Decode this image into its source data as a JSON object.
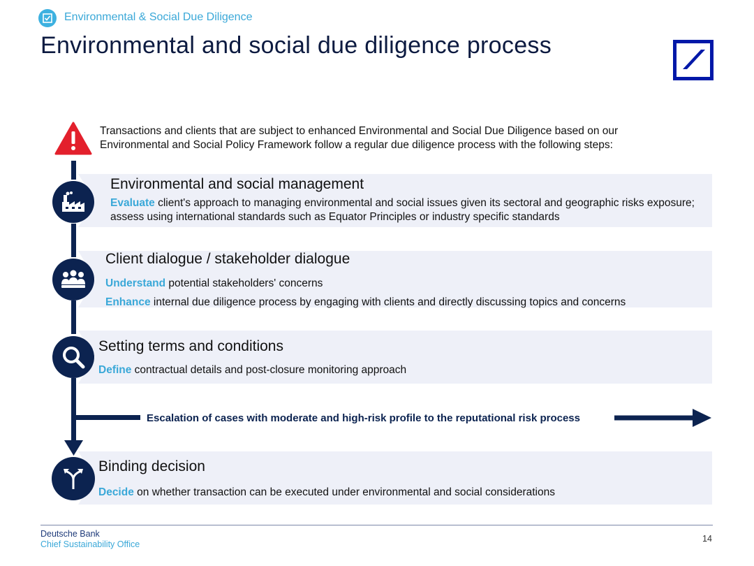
{
  "header": {
    "section_label": "Environmental & Social Due Diligence",
    "title": "Environmental and social due diligence process"
  },
  "intro": {
    "text": "Transactions and clients that are subject to enhanced Environmental and Social Due Diligence based on our Environmental and Social Policy Framework follow a regular due diligence process with the following steps:"
  },
  "steps": [
    {
      "title": "Environmental and social management",
      "icon": "factory-icon",
      "lines": [
        {
          "keyword": "Evaluate",
          "text": " client's approach to managing environmental and social issues given its sectoral and geographic risks exposure; assess using international standards such as Equator Principles or industry specific standards"
        }
      ]
    },
    {
      "title": "Client dialogue / stakeholder dialogue",
      "icon": "people-icon",
      "lines": [
        {
          "keyword": "Understand",
          "text": " potential stakeholders' concerns"
        },
        {
          "keyword": "Enhance",
          "text": " internal due diligence process by engaging with clients and directly discussing topics and concerns"
        }
      ]
    },
    {
      "title": "Setting terms and conditions",
      "icon": "magnifier-icon",
      "lines": [
        {
          "keyword": "Define",
          "text": " contractual details and post-closure monitoring approach"
        }
      ]
    },
    {
      "title": "Binding decision",
      "icon": "fork-arrows-icon",
      "lines": [
        {
          "keyword": "Decide",
          "text": " on whether transaction can be executed under environmental and social considerations"
        }
      ]
    }
  ],
  "escalation": {
    "text": "Escalation of cases with moderate and high-risk profile to the reputational risk process"
  },
  "footer": {
    "company": "Deutsche Bank",
    "office": "Chief Sustainability Office",
    "page_number": "14"
  },
  "colors": {
    "navy": "#0c2350",
    "accent_blue": "#3aa8d8",
    "warning_red": "#e3202c",
    "band": "#eef0f8",
    "logo_blue": "#0018a8"
  }
}
